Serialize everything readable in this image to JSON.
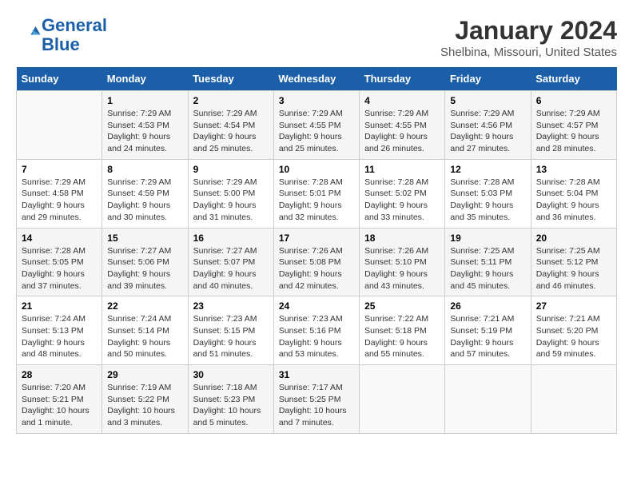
{
  "logo": {
    "text_general": "General",
    "text_blue": "Blue"
  },
  "header": {
    "title": "January 2024",
    "subtitle": "Shelbina, Missouri, United States"
  },
  "weekdays": [
    "Sunday",
    "Monday",
    "Tuesday",
    "Wednesday",
    "Thursday",
    "Friday",
    "Saturday"
  ],
  "weeks": [
    [
      {
        "day": "",
        "info": ""
      },
      {
        "day": "1",
        "info": "Sunrise: 7:29 AM\nSunset: 4:53 PM\nDaylight: 9 hours\nand 24 minutes."
      },
      {
        "day": "2",
        "info": "Sunrise: 7:29 AM\nSunset: 4:54 PM\nDaylight: 9 hours\nand 25 minutes."
      },
      {
        "day": "3",
        "info": "Sunrise: 7:29 AM\nSunset: 4:55 PM\nDaylight: 9 hours\nand 25 minutes."
      },
      {
        "day": "4",
        "info": "Sunrise: 7:29 AM\nSunset: 4:55 PM\nDaylight: 9 hours\nand 26 minutes."
      },
      {
        "day": "5",
        "info": "Sunrise: 7:29 AM\nSunset: 4:56 PM\nDaylight: 9 hours\nand 27 minutes."
      },
      {
        "day": "6",
        "info": "Sunrise: 7:29 AM\nSunset: 4:57 PM\nDaylight: 9 hours\nand 28 minutes."
      }
    ],
    [
      {
        "day": "7",
        "info": "Sunrise: 7:29 AM\nSunset: 4:58 PM\nDaylight: 9 hours\nand 29 minutes."
      },
      {
        "day": "8",
        "info": "Sunrise: 7:29 AM\nSunset: 4:59 PM\nDaylight: 9 hours\nand 30 minutes."
      },
      {
        "day": "9",
        "info": "Sunrise: 7:29 AM\nSunset: 5:00 PM\nDaylight: 9 hours\nand 31 minutes."
      },
      {
        "day": "10",
        "info": "Sunrise: 7:28 AM\nSunset: 5:01 PM\nDaylight: 9 hours\nand 32 minutes."
      },
      {
        "day": "11",
        "info": "Sunrise: 7:28 AM\nSunset: 5:02 PM\nDaylight: 9 hours\nand 33 minutes."
      },
      {
        "day": "12",
        "info": "Sunrise: 7:28 AM\nSunset: 5:03 PM\nDaylight: 9 hours\nand 35 minutes."
      },
      {
        "day": "13",
        "info": "Sunrise: 7:28 AM\nSunset: 5:04 PM\nDaylight: 9 hours\nand 36 minutes."
      }
    ],
    [
      {
        "day": "14",
        "info": "Sunrise: 7:28 AM\nSunset: 5:05 PM\nDaylight: 9 hours\nand 37 minutes."
      },
      {
        "day": "15",
        "info": "Sunrise: 7:27 AM\nSunset: 5:06 PM\nDaylight: 9 hours\nand 39 minutes."
      },
      {
        "day": "16",
        "info": "Sunrise: 7:27 AM\nSunset: 5:07 PM\nDaylight: 9 hours\nand 40 minutes."
      },
      {
        "day": "17",
        "info": "Sunrise: 7:26 AM\nSunset: 5:08 PM\nDaylight: 9 hours\nand 42 minutes."
      },
      {
        "day": "18",
        "info": "Sunrise: 7:26 AM\nSunset: 5:10 PM\nDaylight: 9 hours\nand 43 minutes."
      },
      {
        "day": "19",
        "info": "Sunrise: 7:25 AM\nSunset: 5:11 PM\nDaylight: 9 hours\nand 45 minutes."
      },
      {
        "day": "20",
        "info": "Sunrise: 7:25 AM\nSunset: 5:12 PM\nDaylight: 9 hours\nand 46 minutes."
      }
    ],
    [
      {
        "day": "21",
        "info": "Sunrise: 7:24 AM\nSunset: 5:13 PM\nDaylight: 9 hours\nand 48 minutes."
      },
      {
        "day": "22",
        "info": "Sunrise: 7:24 AM\nSunset: 5:14 PM\nDaylight: 9 hours\nand 50 minutes."
      },
      {
        "day": "23",
        "info": "Sunrise: 7:23 AM\nSunset: 5:15 PM\nDaylight: 9 hours\nand 51 minutes."
      },
      {
        "day": "24",
        "info": "Sunrise: 7:23 AM\nSunset: 5:16 PM\nDaylight: 9 hours\nand 53 minutes."
      },
      {
        "day": "25",
        "info": "Sunrise: 7:22 AM\nSunset: 5:18 PM\nDaylight: 9 hours\nand 55 minutes."
      },
      {
        "day": "26",
        "info": "Sunrise: 7:21 AM\nSunset: 5:19 PM\nDaylight: 9 hours\nand 57 minutes."
      },
      {
        "day": "27",
        "info": "Sunrise: 7:21 AM\nSunset: 5:20 PM\nDaylight: 9 hours\nand 59 minutes."
      }
    ],
    [
      {
        "day": "28",
        "info": "Sunrise: 7:20 AM\nSunset: 5:21 PM\nDaylight: 10 hours\nand 1 minute."
      },
      {
        "day": "29",
        "info": "Sunrise: 7:19 AM\nSunset: 5:22 PM\nDaylight: 10 hours\nand 3 minutes."
      },
      {
        "day": "30",
        "info": "Sunrise: 7:18 AM\nSunset: 5:23 PM\nDaylight: 10 hours\nand 5 minutes."
      },
      {
        "day": "31",
        "info": "Sunrise: 7:17 AM\nSunset: 5:25 PM\nDaylight: 10 hours\nand 7 minutes."
      },
      {
        "day": "",
        "info": ""
      },
      {
        "day": "",
        "info": ""
      },
      {
        "day": "",
        "info": ""
      }
    ]
  ]
}
